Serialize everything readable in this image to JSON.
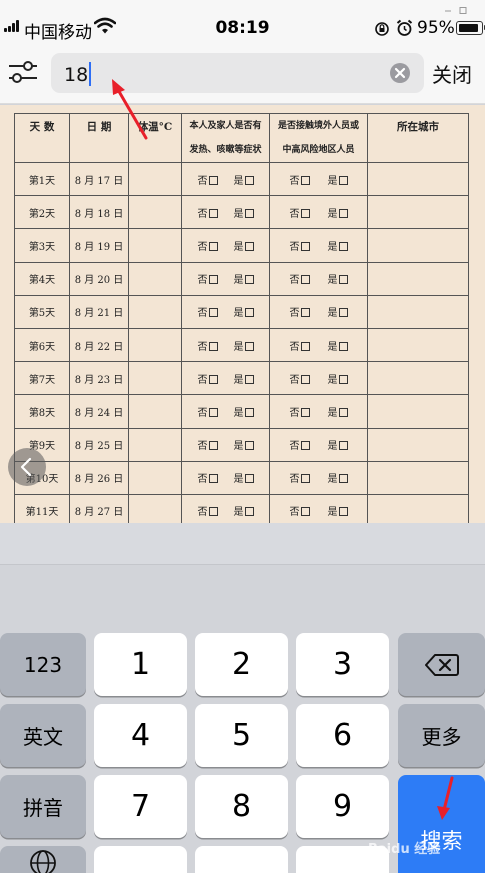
{
  "status_bar": {
    "carrier": "中国移动",
    "time": "08:19",
    "battery_percent": "95%",
    "battery_level": 0.95
  },
  "search_bar": {
    "query": "18",
    "close_label": "关闭"
  },
  "document": {
    "headers": {
      "days": "天  数",
      "date": "日  期",
      "temperature": "体温°C",
      "symptoms": [
        "本人及家人是否有",
        "发热、咳嗽等症状"
      ],
      "contact": [
        "是否接触境外人员或",
        "中高风险地区人员"
      ],
      "city": "所在城市"
    },
    "no_label": "否",
    "yes_label": "是",
    "rows": [
      {
        "day": "第1天",
        "date": "8 月 17 日"
      },
      {
        "day": "第2天",
        "date": "8 月 18 日"
      },
      {
        "day": "第3天",
        "date": "8 月 19 日"
      },
      {
        "day": "第4天",
        "date": "8 月 20 日"
      },
      {
        "day": "第5天",
        "date": "8 月 21 日"
      },
      {
        "day": "第6天",
        "date": "8 月 22 日"
      },
      {
        "day": "第7天",
        "date": "8 月 23 日"
      },
      {
        "day": "第8天",
        "date": "8 月 24 日"
      },
      {
        "day": "第9天",
        "date": "8 月 25 日"
      },
      {
        "day": "第10天",
        "date": "8 月 26 日"
      },
      {
        "day": "第11天",
        "date": "8 月 27 日"
      }
    ]
  },
  "keyboard": {
    "key_123": "123",
    "key_english": "英文",
    "key_pinyin": "拼音",
    "key_more": "更多",
    "key_search": "搜索",
    "digits": [
      "1",
      "2",
      "3",
      "4",
      "5",
      "6",
      "7",
      "8",
      "9"
    ]
  },
  "watermark": "Baidu 经验",
  "colors": {
    "accent": "#2d7cf6",
    "annotation": "#e8202a",
    "document_bg": "#f3e5d4"
  }
}
